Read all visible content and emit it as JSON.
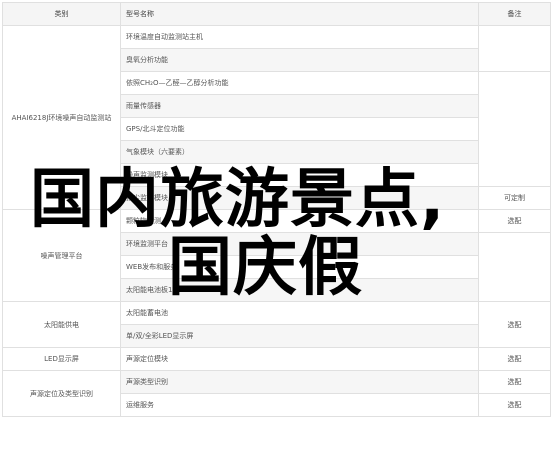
{
  "table": {
    "headers": {
      "category": "类别",
      "item": "型号名称",
      "note": "备注"
    },
    "rows": [
      {
        "item": "环境温度自动监测站主机",
        "note": "",
        "alt": false
      },
      {
        "item": "臭氧分析功能",
        "note": "",
        "alt": true
      },
      {
        "item": "依照CH₂O—乙醛—乙醇分析功能",
        "note": "",
        "alt": false
      },
      {
        "item": "雨量传感器",
        "note": "",
        "alt": true
      },
      {
        "item": "GPS/北斗定位功能",
        "note": "",
        "alt": false
      },
      {
        "item": "气象模块（六要素）",
        "note": "",
        "alt": true
      },
      {
        "item": "噪声监测模块",
        "note": "",
        "alt": false
      },
      {
        "item": "扬尘监测模块",
        "note": "可定制",
        "alt": true
      },
      {
        "item": "颗粒物监测",
        "note": "选配",
        "alt": false
      },
      {
        "item": "环境监测平台",
        "note": "",
        "alt": true
      },
      {
        "item": "WEB发布和服务",
        "note": "",
        "alt": false
      },
      {
        "item": "太阳能电池板150W",
        "note": "",
        "alt": true
      },
      {
        "item": "太阳能蓄电池",
        "note": "选配",
        "alt": false
      },
      {
        "item": "单/双/全彩LED显示屏",
        "note": "选配",
        "alt": true
      },
      {
        "item": "声源定位模块",
        "note": "选配",
        "alt": false
      },
      {
        "item": "声源类型识别",
        "note": "选配",
        "alt": true
      },
      {
        "item": "运维服务",
        "note": "选配",
        "alt": false
      }
    ],
    "groups": {
      "g1": "AHAI6218J环境噪声自动监测站",
      "g2": "噪声管理平台",
      "g3": "太阳能供电",
      "g4": "LED显示屏",
      "g5": "声源定位及类型识别",
      "g6": "服务"
    }
  },
  "overlay": {
    "line1": "国内旅游景点,",
    "line2": "国庆假"
  }
}
